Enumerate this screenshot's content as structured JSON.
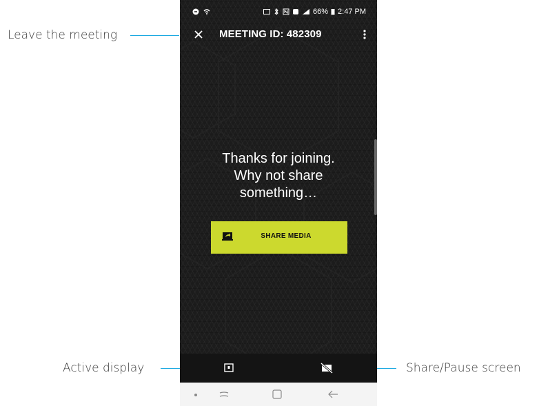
{
  "callouts": {
    "leave": "Leave the meeting",
    "active_display": "Active display",
    "share_pause": "Share/Pause screen"
  },
  "status_bar": {
    "battery": "66%",
    "time": "2:47 PM"
  },
  "app_bar": {
    "title": "MEETING ID: 482309",
    "close_icon": "close-icon",
    "more_icon": "more-vertical-icon"
  },
  "message": {
    "line1": "Thanks for joining.",
    "line2": "Why not share",
    "line3": "something…"
  },
  "share_button": {
    "label": "SHARE MEDIA",
    "icon": "share-screen-icon"
  },
  "colors": {
    "accent": "#ccd92e",
    "background": "#1c1c1c",
    "callout_line": "#1ba9e1"
  }
}
